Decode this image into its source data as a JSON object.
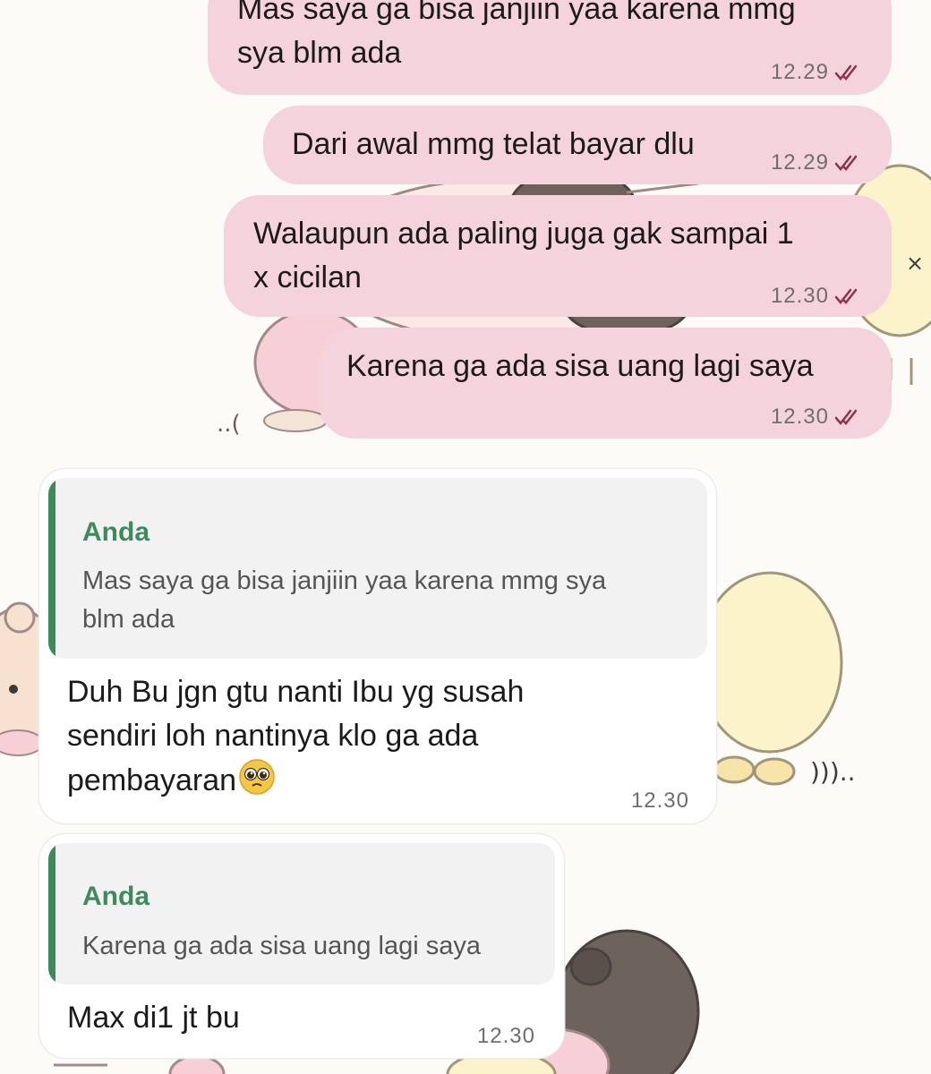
{
  "outgoing": [
    {
      "text": "Mas saya ga bisa janjiin yaa karena mmg\nsya blm ada",
      "time": "12.29",
      "status": "read-double-tick-icon"
    },
    {
      "text": "Dari awal mmg telat bayar dlu",
      "time": "12.29",
      "status": "read-double-tick-icon"
    },
    {
      "text": "Walaupun ada paling juga gak sampai 1\nx cicilan",
      "time": "12.30",
      "status": "read-double-tick-icon"
    },
    {
      "text": "Karena ga ada sisa uang lagi saya",
      "time": "12.30",
      "status": "read-double-tick-icon"
    }
  ],
  "incoming": [
    {
      "quote_author": "Anda",
      "quote_text": "Mas saya ga bisa janjiin yaa karena mmg sya\nblm ada",
      "text": "Duh Bu jgn gtu nanti Ibu yg susah\nsendiri loh nantinya klo ga ada\npembayaran",
      "emoji": "pleading-face-icon",
      "time": "12.30"
    },
    {
      "quote_author": "Anda",
      "quote_text": "Karena ga ada sisa uang lagi saya",
      "text": "Max di1 jt bu",
      "time": "12.30"
    }
  ],
  "colors": {
    "outgoing_bubble": "#f5d3dc",
    "incoming_bubble": "#ffffff",
    "quote_accent": "#3c8b5b",
    "read_ticks": "#8c3246",
    "wallpaper": "#fdfbf7"
  }
}
